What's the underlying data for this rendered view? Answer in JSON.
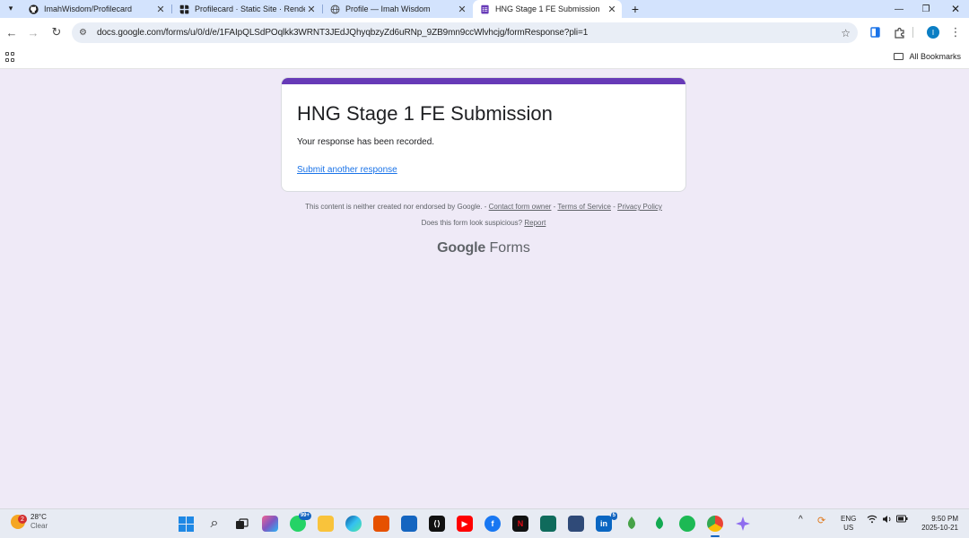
{
  "browser": {
    "tabs": [
      {
        "title": "ImahWisdom/Profilecard",
        "icon": "github-icon"
      },
      {
        "title": "Profilecard · Static Site · Rende",
        "icon": "render-icon"
      },
      {
        "title": "Profile — Imah Wisdom",
        "icon": "globe-icon"
      },
      {
        "title": "HNG Stage 1 FE Submission",
        "icon": "google-forms-icon",
        "active": true
      }
    ],
    "url": "docs.google.com/forms/u/0/d/e/1FAIpQLSdPOqlkk3WRNT3JEdJQhyqbzyZd6uRNp_9ZB9mn9ccWlvhcjg/formResponse?pli=1",
    "profile_initial": "I",
    "bookmarks_label": "All Bookmarks"
  },
  "form": {
    "accent_color": "#673ab7",
    "title": "HNG Stage 1 FE Submission",
    "message": "Your response has been recorded.",
    "link": "Submit another response"
  },
  "footer": {
    "disclaimer": "This content is neither created nor endorsed by Google.",
    "contact": "Contact form owner",
    "terms": "Terms of Service",
    "privacy": "Privacy Policy",
    "suspicious": "Does this form look suspicious?",
    "report": "Report",
    "brand_google": "Google",
    "brand_forms": "Forms"
  },
  "taskbar": {
    "weather_badge": "2",
    "temperature": "28°C",
    "condition": "Clear",
    "whatsapp_badge": "99+",
    "linkedin_badge": "5",
    "lang_line1": "ENG",
    "lang_line2": "US",
    "time": "9:50 PM",
    "date": "2025-10-21"
  }
}
